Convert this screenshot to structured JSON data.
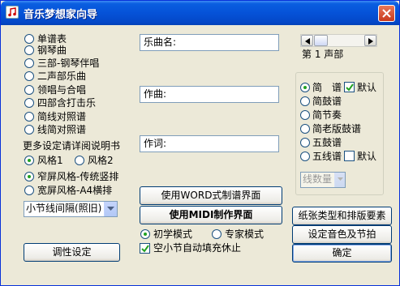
{
  "window": {
    "title": "音乐梦想家向导",
    "icon": "music-note-icon",
    "close_icon": "close-icon"
  },
  "score_types": [
    {
      "label": "单谱表",
      "selected": false
    },
    {
      "label": "钢琴曲",
      "selected": false
    },
    {
      "label": "三部-钢琴伴唱",
      "selected": false
    },
    {
      "label": "二声部乐曲",
      "selected": false
    },
    {
      "label": "领唱与合唱",
      "selected": false
    },
    {
      "label": "四部含打击乐",
      "selected": false
    },
    {
      "label": "简线对照谱",
      "selected": false
    },
    {
      "label": "线简对照谱",
      "selected": false
    }
  ],
  "settings_hint": "更多设定请详阅说明书",
  "styles": [
    {
      "label": "风格1",
      "selected": true
    },
    {
      "label": "风格2",
      "selected": false
    }
  ],
  "layouts": [
    {
      "label": "窄屏风格-传统竖排",
      "selected": true
    },
    {
      "label": "宽屏风格-A4横排",
      "selected": false
    }
  ],
  "bar_spacing_select": {
    "value": "小节线间隔(照旧)"
  },
  "tuning_button": "调性设定",
  "fields": {
    "title_value": "乐曲名:",
    "composer_value": "作曲:",
    "lyricist_value": "作词:"
  },
  "buttons": {
    "word_style": "使用WORD式制谱界面",
    "midi": "使用MIDI制作界面",
    "paper": "纸张类型和排版要素",
    "timbre": "设定音色及节拍",
    "ok": "确定"
  },
  "modes": [
    {
      "label": "初学模式",
      "selected": true
    },
    {
      "label": "专家模式",
      "selected": false
    }
  ],
  "auto_fill_rest": {
    "label": "空小节自动填充休止",
    "checked": true
  },
  "part_scroll": {
    "label": "第 1 声部",
    "position": 0.0
  },
  "notation": [
    {
      "label": "简　谱",
      "selected": true
    },
    {
      "label": "简鼓谱",
      "selected": false
    },
    {
      "label": "简节奏",
      "selected": false
    },
    {
      "label": "简老版鼓谱",
      "selected": false
    },
    {
      "label": "五鼓谱",
      "selected": false
    },
    {
      "label": "五线谱",
      "selected": false
    }
  ],
  "default_checks": {
    "jianpu_default": {
      "label": "默认",
      "checked": true
    },
    "staff_default": {
      "label": "默认",
      "checked": false
    }
  },
  "line_count_select": {
    "value": "线数量",
    "disabled": true
  },
  "colors": {
    "titlebar": "#0552d8",
    "window_bg": "#ece9d8",
    "radio_dot": "#21a121",
    "close_button": "#c9391c"
  }
}
